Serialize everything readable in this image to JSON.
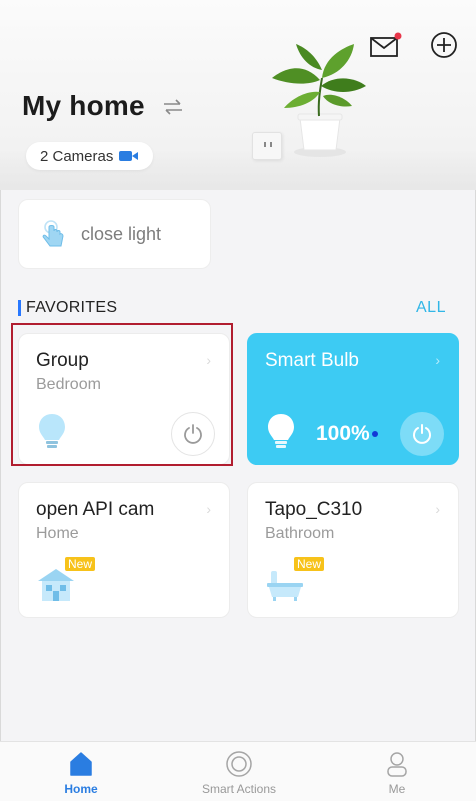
{
  "header": {
    "title": "My home",
    "switch_icon": "swap-arrows-icon",
    "cameras_label": "2 Cameras",
    "notification_dot_color": "#e8364a"
  },
  "scene": {
    "label": "close light",
    "icon": "tap-hand-icon"
  },
  "favorites": {
    "title": "FAVORITES",
    "all_label": "ALL",
    "accent": "#2878ff",
    "devices": [
      {
        "name": "Group",
        "room": "Bedroom",
        "icon": "bulb-icon",
        "power": "off"
      },
      {
        "name": "Smart Bulb",
        "room": "",
        "brightness": "100%",
        "icon": "bulb-icon",
        "power": "on",
        "card_color": "#3dcbf3"
      },
      {
        "name": "open API cam",
        "room": "Home",
        "badge": "New",
        "icon": "house-icon"
      },
      {
        "name": "Tapo_C310",
        "room": "Bathroom",
        "badge": "New",
        "icon": "bathtub-icon"
      }
    ]
  },
  "nav": {
    "home": "Home",
    "smart_actions": "Smart Actions",
    "me": "Me",
    "active_color": "#2a7de1"
  }
}
